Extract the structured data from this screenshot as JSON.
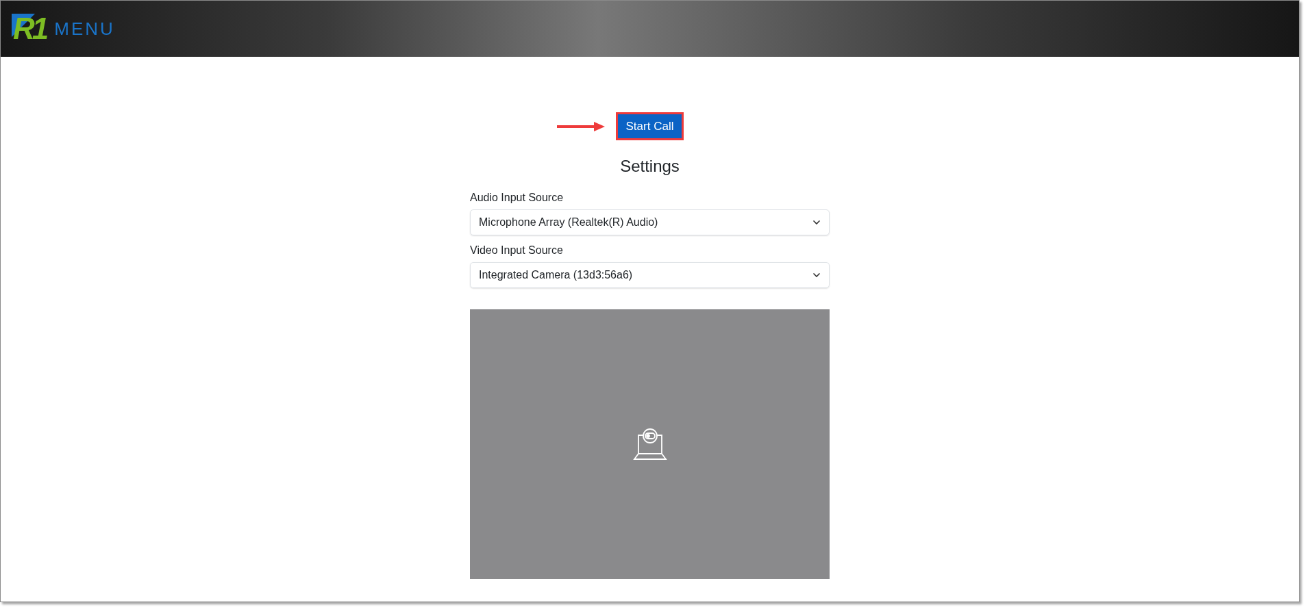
{
  "header": {
    "logo_mark": "R1",
    "logo_text": "MENU"
  },
  "start_call": {
    "label": "Start Call",
    "highlighted": true
  },
  "settings": {
    "title": "Settings",
    "fields": [
      {
        "label": "Audio Input Source",
        "value": "Microphone Array (Realtek(R) Audio)"
      },
      {
        "label": "Video Input Source",
        "value": "Integrated Camera (13d3:56a6)"
      }
    ]
  },
  "video_preview": {
    "camera_on": false
  }
}
